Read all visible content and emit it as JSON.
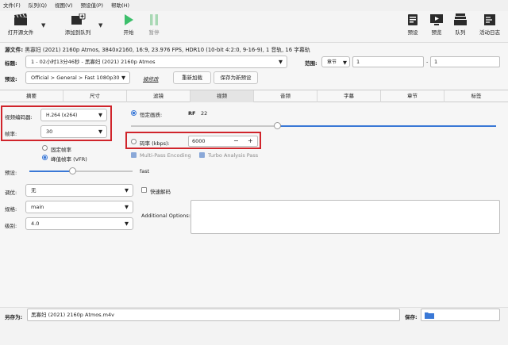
{
  "menu": [
    "文件(F)",
    "队列(Q)",
    "视图(V)",
    "预设值(P)",
    "帮助(H)"
  ],
  "toolbar": {
    "open_source": "打开源文件",
    "add_queue": "添加到队列",
    "start": "开始",
    "pause": "暂停",
    "presets": "预设",
    "preview": "预览",
    "queue": "队列",
    "activity_log": "活动日志"
  },
  "source": {
    "label": "源文件:",
    "value": "黑寡妇 (2021) 2160p Atmos, 3840x2160, 16:9, 23.976 FPS, HDR10 (10-bit 4:2:0, 9-16-9), 1 音轨, 16 字幕轨"
  },
  "title": {
    "label": "标题:",
    "value": "1 - 02小时13分46秒 - 黑寡妇 (2021) 2160p Atmos",
    "range_label": "范围:",
    "range_type": "章节",
    "range_start": "1",
    "range_sep": "-",
    "range_end": "1"
  },
  "preset": {
    "label": "预设:",
    "path": [
      "Official",
      "General",
      "Fast 1080p30"
    ],
    "sep": ">",
    "modified": "被修改",
    "reload": "重新加载",
    "save_new": "保存为新预设"
  },
  "tabs": [
    "摘要",
    "尺寸",
    "滤镜",
    "视频",
    "音频",
    "字幕",
    "章节",
    "标签"
  ],
  "active_tab": 3,
  "video": {
    "encoder_label": "视频编码器:",
    "encoder_value": "H.264 (x264)",
    "framerate_label": "帧率:",
    "framerate_value": "30",
    "cfr_label": "固定帧率",
    "pfr_label": "峰值帧率 (VFR)",
    "quality_label": "恒定画质:",
    "rf_label": "RF",
    "rf_value": "22",
    "bitrate_label": "码率 (kbps):",
    "bitrate_value": "6000",
    "minus": "−",
    "plus": "+",
    "multipass_label": "Multi-Pass Encoding",
    "turbo_label": "Turbo Analysis Pass",
    "preset_label": "预设:",
    "preset_speed": "fast",
    "preset_level": 0.42,
    "rf_level": 0.4,
    "tune_label": "调优:",
    "tune_value": "无",
    "fastdecode_label": "快速解码",
    "profile_label": "规格:",
    "profile_value": "main",
    "level_label": "级别:",
    "level_value": "4.0",
    "additional_label": "Additional Options:",
    "additional_value": ""
  },
  "save": {
    "label": "另存为:",
    "filename": "黑寡妇 (2021) 2160p Atmos.m4v",
    "to_label": "保存:"
  },
  "colors": {
    "accent": "#3a78d6",
    "highlight": "#d0242b"
  }
}
